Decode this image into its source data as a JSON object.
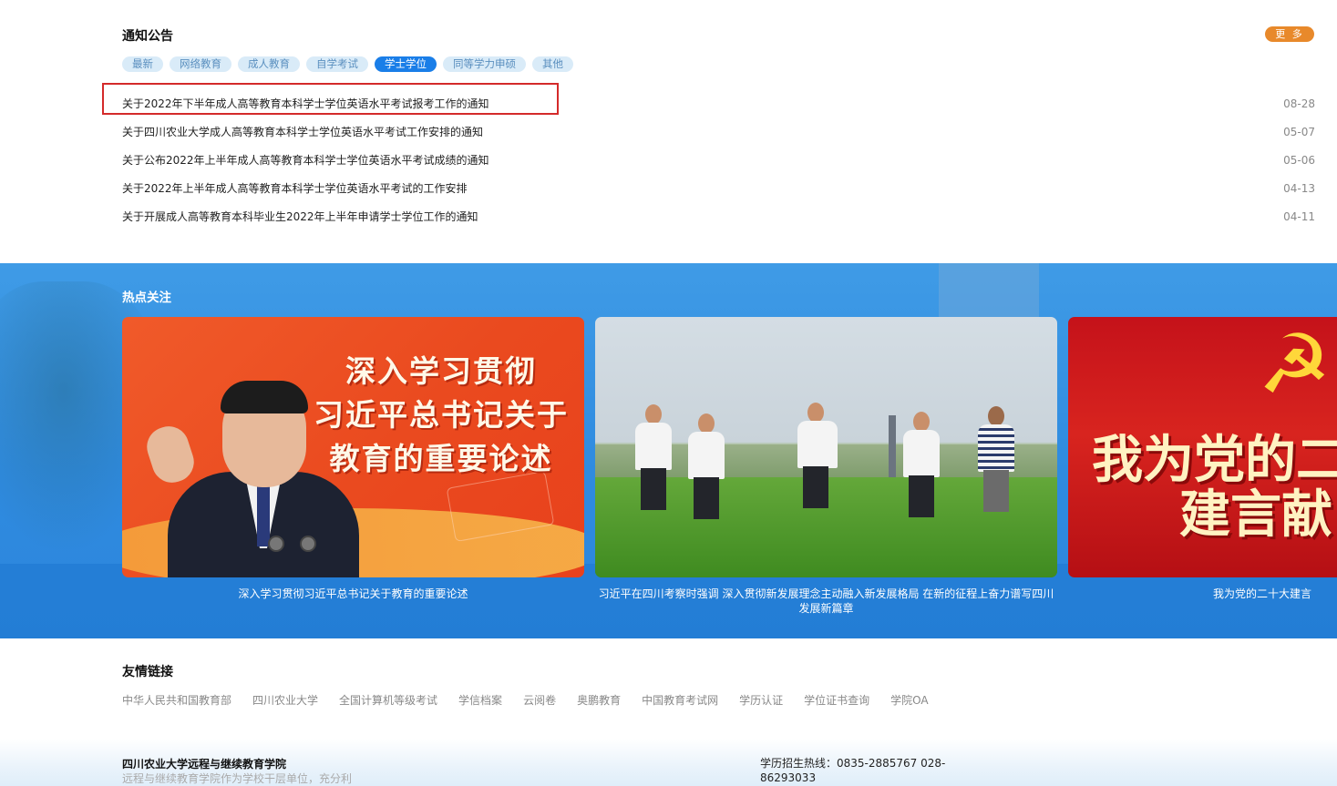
{
  "notice": {
    "title": "通知公告",
    "more_label": "更 多",
    "tabs": [
      {
        "label": "最新",
        "active": false
      },
      {
        "label": "网络教育",
        "active": false
      },
      {
        "label": "成人教育",
        "active": false
      },
      {
        "label": "自学考试",
        "active": false
      },
      {
        "label": "学士学位",
        "active": true
      },
      {
        "label": "同等学力申硕",
        "active": false
      },
      {
        "label": "其他",
        "active": false
      }
    ],
    "items": [
      {
        "title": "关于2022年下半年成人高等教育本科学士学位英语水平考试报考工作的通知",
        "date": "08-28"
      },
      {
        "title": "关于四川农业大学成人高等教育本科学士学位英语水平考试工作安排的通知",
        "date": "05-07"
      },
      {
        "title": "关于公布2022年上半年成人高等教育本科学士学位英语水平考试成绩的通知",
        "date": "05-06"
      },
      {
        "title": "关于2022年上半年成人高等教育本科学士学位英语水平考试的工作安排",
        "date": "04-13"
      },
      {
        "title": "关于开展成人高等教育本科毕业生2022年上半年申请学士学位工作的通知",
        "date": "04-11"
      }
    ]
  },
  "hot": {
    "title": "热点关注",
    "cards": [
      {
        "headline": [
          "深入学习贯彻",
          "习近平总书记关于",
          "教育的重要论述"
        ],
        "caption": "深入学习贯彻习近平总书记关于教育的重要论述"
      },
      {
        "caption": "习近平在四川考察时强调 深入贯彻新发展理念主动融入新发展格局 在新的征程上奋力谱写四川发展新篇章"
      },
      {
        "headline": [
          "我为党的二",
          "建言献"
        ],
        "caption": "我为党的二十大建言"
      }
    ]
  },
  "links": {
    "title": "友情链接",
    "items": [
      "中华人民共和国教育部",
      "四川农业大学",
      "全国计算机等级考试",
      "学信档案",
      "云阅卷",
      "奥鹏教育",
      "中国教育考试网",
      "学历认证",
      "学位证书查询",
      "学院OA"
    ]
  },
  "footer": {
    "org_name": "四川农业大学远程与继续教育学院",
    "description": "远程与继续教育学院作为学校干层单位，充分利",
    "hotline": "学历招生热线：0835-2885767 028-86293033"
  },
  "colors": {
    "accent_blue": "#1a7ee8",
    "more_orange": "#e8892b",
    "highlight_red": "#d42a2a"
  }
}
